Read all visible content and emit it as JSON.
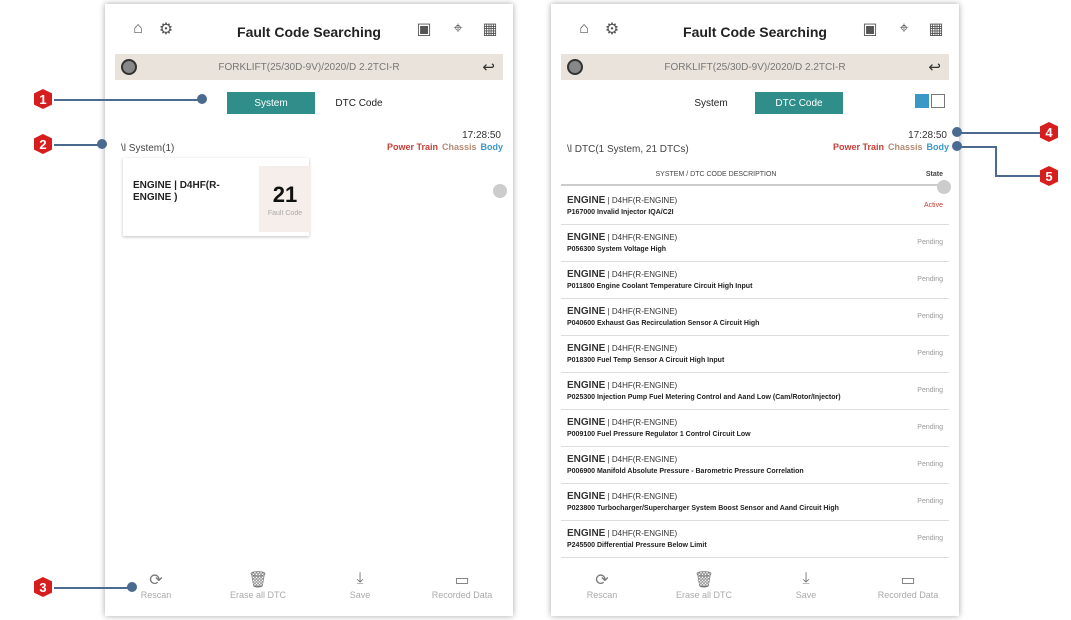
{
  "left": {
    "title": "Fault Code Searching",
    "vehicle": "FORKLIFT(25/30D-9V)/2020/D 2.2TCI-R",
    "tabs": [
      "System",
      "DTC Code"
    ],
    "timestamp": "17:28:50",
    "summary": "\\l System(1)",
    "filters": {
      "power_train": "Power Train",
      "chassis": "Chassis",
      "body": "Body"
    },
    "system_card": {
      "name": "ENGINE | D4HF(R-ENGINE )",
      "count": "21",
      "count_label": "Fault Code"
    },
    "bottom": [
      "Rescan",
      "Erase all DTC",
      "Save",
      "Recorded Data"
    ]
  },
  "right": {
    "title": "Fault Code Searching",
    "vehicle": "FORKLIFT(25/30D-9V)/2020/D 2.2TCI-R",
    "tabs": [
      "System",
      "DTC Code"
    ],
    "timestamp": "17:28:50",
    "summary": "\\l DTC(1 System, 21 DTCs)",
    "filters": {
      "power_train": "Power Train",
      "chassis": "Chassis",
      "body": "Body"
    },
    "table_header": {
      "desc": "SYSTEM / DTC CODE DESCRIPTION",
      "state": "State"
    },
    "rows": [
      {
        "system": "ENGINE",
        "sub": "D4HF(R-ENGINE)",
        "code": "P167000 Invalid Injector IQA/C2I",
        "state": "Active"
      },
      {
        "system": "ENGINE",
        "sub": "D4HF(R-ENGINE)",
        "code": "P056300 System Voltage High",
        "state": "Pending"
      },
      {
        "system": "ENGINE",
        "sub": "D4HF(R-ENGINE)",
        "code": "P011800 Engine Coolant Temperature Circuit High Input",
        "state": "Pending"
      },
      {
        "system": "ENGINE",
        "sub": "D4HF(R-ENGINE)",
        "code": "P040600 Exhaust Gas Recirculation Sensor A Circuit High",
        "state": "Pending"
      },
      {
        "system": "ENGINE",
        "sub": "D4HF(R-ENGINE)",
        "code": "P018300 Fuel Temp Sensor A Circuit High Input",
        "state": "Pending"
      },
      {
        "system": "ENGINE",
        "sub": "D4HF(R-ENGINE)",
        "code": "P025300 Injection Pump Fuel Metering Control and Aand  Low (Cam/Rotor/Injector)",
        "state": "Pending"
      },
      {
        "system": "ENGINE",
        "sub": "D4HF(R-ENGINE)",
        "code": "P009100 Fuel Pressure Regulator 1 Control Circuit Low",
        "state": "Pending"
      },
      {
        "system": "ENGINE",
        "sub": "D4HF(R-ENGINE)",
        "code": "P006900 Manifold Absolute Pressure - Barometric Pressure Correlation",
        "state": "Pending"
      },
      {
        "system": "ENGINE",
        "sub": "D4HF(R-ENGINE)",
        "code": "P023800 Turbocharger/Supercharger System Boost Sensor and Aand  Circuit High",
        "state": "Pending"
      },
      {
        "system": "ENGINE",
        "sub": "D4HF(R-ENGINE)",
        "code": "P245500 Differential Pressure Below Limit",
        "state": "Pending"
      }
    ],
    "bottom": [
      "Rescan",
      "Erase all DTC",
      "Save",
      "Recorded Data"
    ]
  },
  "callouts": [
    "1",
    "2",
    "3",
    "4",
    "5"
  ],
  "colors": {
    "teal": "#2f8e8a",
    "red": "#c64037",
    "blue": "#3a98c7",
    "callout": "#d61e1e"
  }
}
